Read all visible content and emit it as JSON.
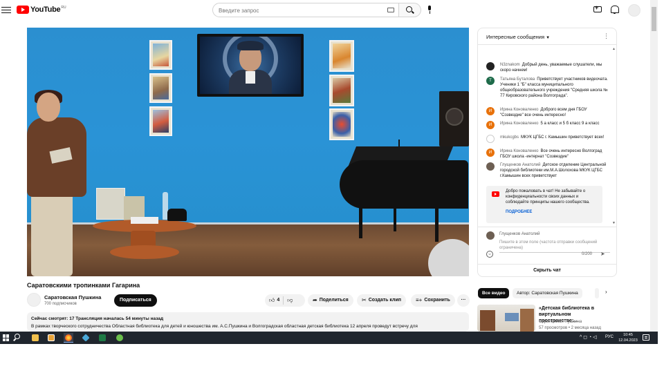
{
  "brand": {
    "name": "YouTube",
    "region": "RU",
    "color": "#ff0000"
  },
  "search": {
    "placeholder": "Введите запрос"
  },
  "video": {
    "title": "Саратовскими тропинками Гагарина",
    "channel": "Саратовская Пушкина",
    "subscribers": "700 подписчиков",
    "subscribe_label": "Подписаться",
    "likes": "4",
    "share_label": "Поделиться",
    "clip_label": "Создать клип",
    "save_label": "Сохранить",
    "more_label": "···",
    "description": {
      "stats": "Сейчас смотрят: 17  Трансляция началась 54 минуты назад",
      "text": "В рамках творческого сотрудничества Областная библиотека для детей и юношества им. А.С.Пушкина и Волгоградская областная детская библиотека 12 апреля проведут встречу для"
    }
  },
  "chat": {
    "mode_label": "Интересные сообщения",
    "messages": [
      {
        "author": "N3znakom",
        "text": "Добрый день, уважаемые слушатели, мы скоро начнем!",
        "avatar": "",
        "avatar_color": "#222222"
      },
      {
        "author": "Татьяна Буталова",
        "text": "Приветствует участников видеочата. Ученики 1 \"Б\" класса муниципального общеобразовательного учреждения \"Средняя школа № 77 Кировского района Волгограда\".",
        "avatar": "Т",
        "avatar_color": "#1e6b4a"
      },
      {
        "author": "Ирина Коноваленко",
        "text": "Доброго всем дня ГБОУ \"Созвездие\" все очень интересно!",
        "avatar": "И",
        "avatar_color": "#e8710a"
      },
      {
        "author": "Ирина Коноваленко",
        "text": "5 а класс и 5 б класс 9 а класс",
        "avatar": "И",
        "avatar_color": "#e8710a"
      },
      {
        "author": "mkukcgbs",
        "text": "МКУК ЦГБС г. Камышин приветствует всех!",
        "avatar": "",
        "avatar_color": "#ffffff"
      },
      {
        "author": "Ирина Коноваленко",
        "text": "Все очень интересно Волгоград ГБОУ школа -интернат \"Созвездие\"",
        "avatar": "И",
        "avatar_color": "#e8710a"
      },
      {
        "author": "Глущенков Анатолий",
        "text": "Детское отделение Центральной городской библиотеки им.М.А.Шолохова МКУК ЦГБС г.Камышин всех приветствует",
        "avatar": "",
        "avatar_color": "#6d5f53"
      }
    ],
    "welcome": {
      "text": "Добро пожаловать в чат! Не забывайте о конфиденциальности своих данных и соблюдайте принципы нашего сообщества.",
      "link": "ПОДРОБНЕЕ"
    },
    "input": {
      "user": "Глущенков Анатолий",
      "placeholder": "Пишите в этом поле (частота отправки сообщений ограничена)",
      "counter": "0/200"
    },
    "toggle_label": "Скрыть чат"
  },
  "recommendations": {
    "chips": [
      "Все видео",
      "Автор: Саратовская Пушкина"
    ],
    "items": [
      {
        "title": "«Детская библиотека в виртуальном пространстве:...",
        "channel": "Саратовская Пушкина",
        "meta": "57 просмотров • 2 месяца назад"
      }
    ]
  },
  "taskbar": {
    "language": "РУС",
    "time": "10:45",
    "date": "12.04.2023",
    "tray_symbols": "^ ◻ ◔ ◁"
  }
}
